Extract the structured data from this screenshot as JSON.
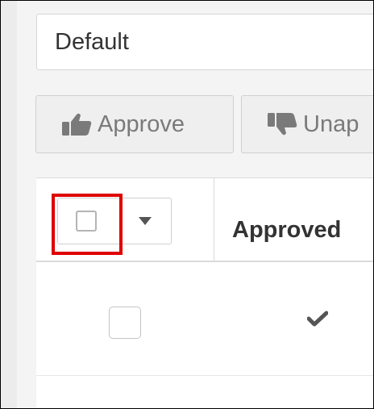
{
  "view_selector": {
    "value": "Default"
  },
  "toolbar": {
    "approve_label": "Approve",
    "unapprove_label": "Unap",
    "approve_icon": "thumbs-up-icon",
    "unapprove_icon": "thumbs-down-icon"
  },
  "table": {
    "columns": [
      {
        "label": "Approved"
      }
    ],
    "rows": [
      {
        "selected": false,
        "approved": true
      }
    ]
  },
  "colors": {
    "highlight": "#e00000",
    "button_text": "#7a7a7a"
  }
}
